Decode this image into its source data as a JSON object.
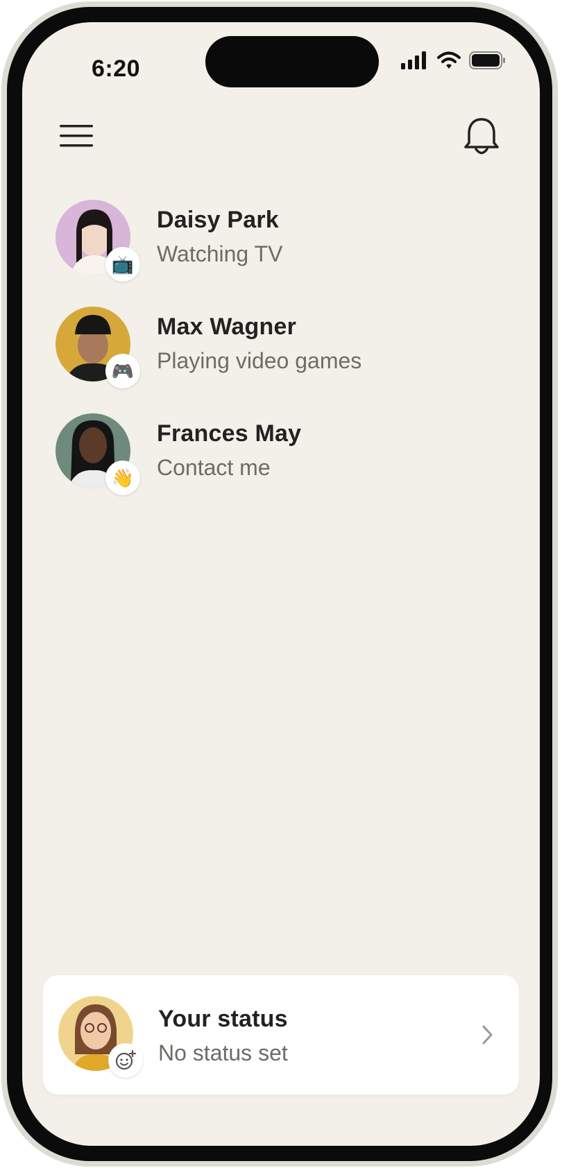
{
  "status_bar": {
    "time": "6:20"
  },
  "header": {
    "menu_icon": "hamburger-menu-icon",
    "notification_icon": "bell-icon"
  },
  "contacts": [
    {
      "name": "Daisy Park",
      "activity": "Watching TV",
      "emoji": "📺",
      "avatar_bg": "#d7b6d9"
    },
    {
      "name": "Max Wagner",
      "activity": "Playing video games",
      "emoji": "🎮",
      "avatar_bg": "#d6a83a"
    },
    {
      "name": "Frances May",
      "activity": "Contact me",
      "emoji": "👋",
      "avatar_bg": "#6f8a7c"
    }
  ],
  "your_status": {
    "title": "Your status",
    "subtitle": "No status set",
    "avatar_bg": "#f0d48e",
    "badge_icon": "add-emoji-icon",
    "chevron_icon": "chevron-right-icon"
  },
  "colors": {
    "background": "#f2f0e8",
    "card": "#ffffff",
    "text_primary": "#222222",
    "text_secondary": "#6e6c66"
  }
}
